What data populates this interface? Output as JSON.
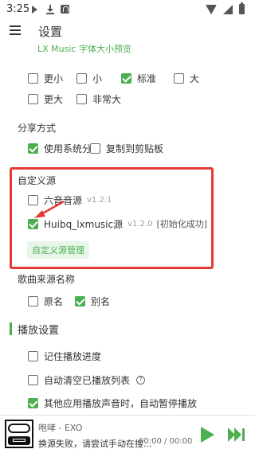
{
  "status_bar": {
    "time": "3:25",
    "icons": [
      "play-notification-icon",
      "download-icon",
      "a-icon",
      "wifi-icon",
      "signal-icon",
      "battery-icon"
    ]
  },
  "app_bar": {
    "title": "设置",
    "menu_icon": "hamburger-icon"
  },
  "font_size": {
    "preview": "LX Music 字体大小预览",
    "options": [
      {
        "label": "更小",
        "checked": false
      },
      {
        "label": "小",
        "checked": false
      },
      {
        "label": "标准",
        "checked": true
      },
      {
        "label": "大",
        "checked": false
      },
      {
        "label": "更大",
        "checked": false
      },
      {
        "label": "非常大",
        "checked": false
      }
    ]
  },
  "share": {
    "title": "分享方式",
    "options": [
      {
        "label": "使用系统分享",
        "checked": true
      },
      {
        "label": "复制到剪贴板",
        "checked": false
      }
    ]
  },
  "custom_source": {
    "title": "自定义源",
    "sources": [
      {
        "name": "六音音源",
        "version": "v1.2.1",
        "status": "",
        "checked": false
      },
      {
        "name": "Huibq_lxmusic源",
        "version": "v1.2.0",
        "status": "[初始化成功]",
        "checked": true
      }
    ],
    "manage_button": "自定义源管理"
  },
  "source_name": {
    "title": "歌曲来源名称",
    "options": [
      {
        "label": "原名",
        "checked": false
      },
      {
        "label": "别名",
        "checked": true
      }
    ]
  },
  "playback": {
    "title": "播放设置",
    "options": [
      {
        "label": "记住播放进度",
        "checked": false
      },
      {
        "label": "自动清空已播放列表",
        "checked": false,
        "help_icon": "help-icon"
      },
      {
        "label": "其他应用播放声音时，自动暂停播放",
        "checked": true
      }
    ]
  },
  "player": {
    "title": "咆哮 - EXO",
    "status": "换源失败，请尝试手动在搜...",
    "time": "00:00 / 00:00",
    "play_icon": "play-icon",
    "next_icon": "next-icon"
  },
  "colors": {
    "accent": "#4caf50",
    "highlight": "#e53935"
  }
}
